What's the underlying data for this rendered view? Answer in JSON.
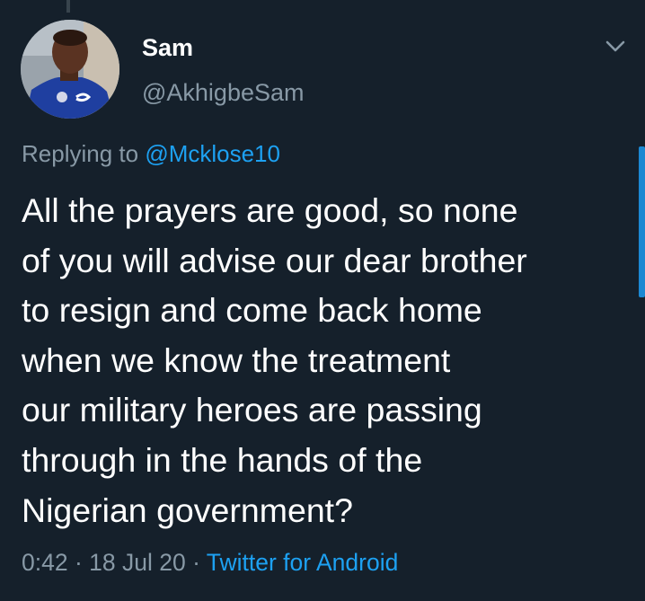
{
  "tweet": {
    "author": {
      "display_name": "Sam",
      "handle": "@AkhigbeSam",
      "avatar_icon": "profile-photo"
    },
    "replying_to": {
      "prefix": "Replying to ",
      "mention": "@Mcklose10"
    },
    "text_lines": [
      "All the prayers are good, so none",
      "of you will advise our dear brother",
      "to resign and come back home",
      "when we know the treatment",
      "our military heroes are passing",
      "through in the hands of the",
      "Nigerian government?"
    ],
    "meta": {
      "time": "0:42",
      "date": "18 Jul 20",
      "separator": " · ",
      "source": "Twitter for Android"
    },
    "menu_icon": "chevron-down-icon"
  },
  "colors": {
    "background": "#15202b",
    "text_primary": "#ffffff",
    "text_secondary": "#8899a6",
    "accent": "#1da1f2",
    "thread_line": "#38444d"
  }
}
